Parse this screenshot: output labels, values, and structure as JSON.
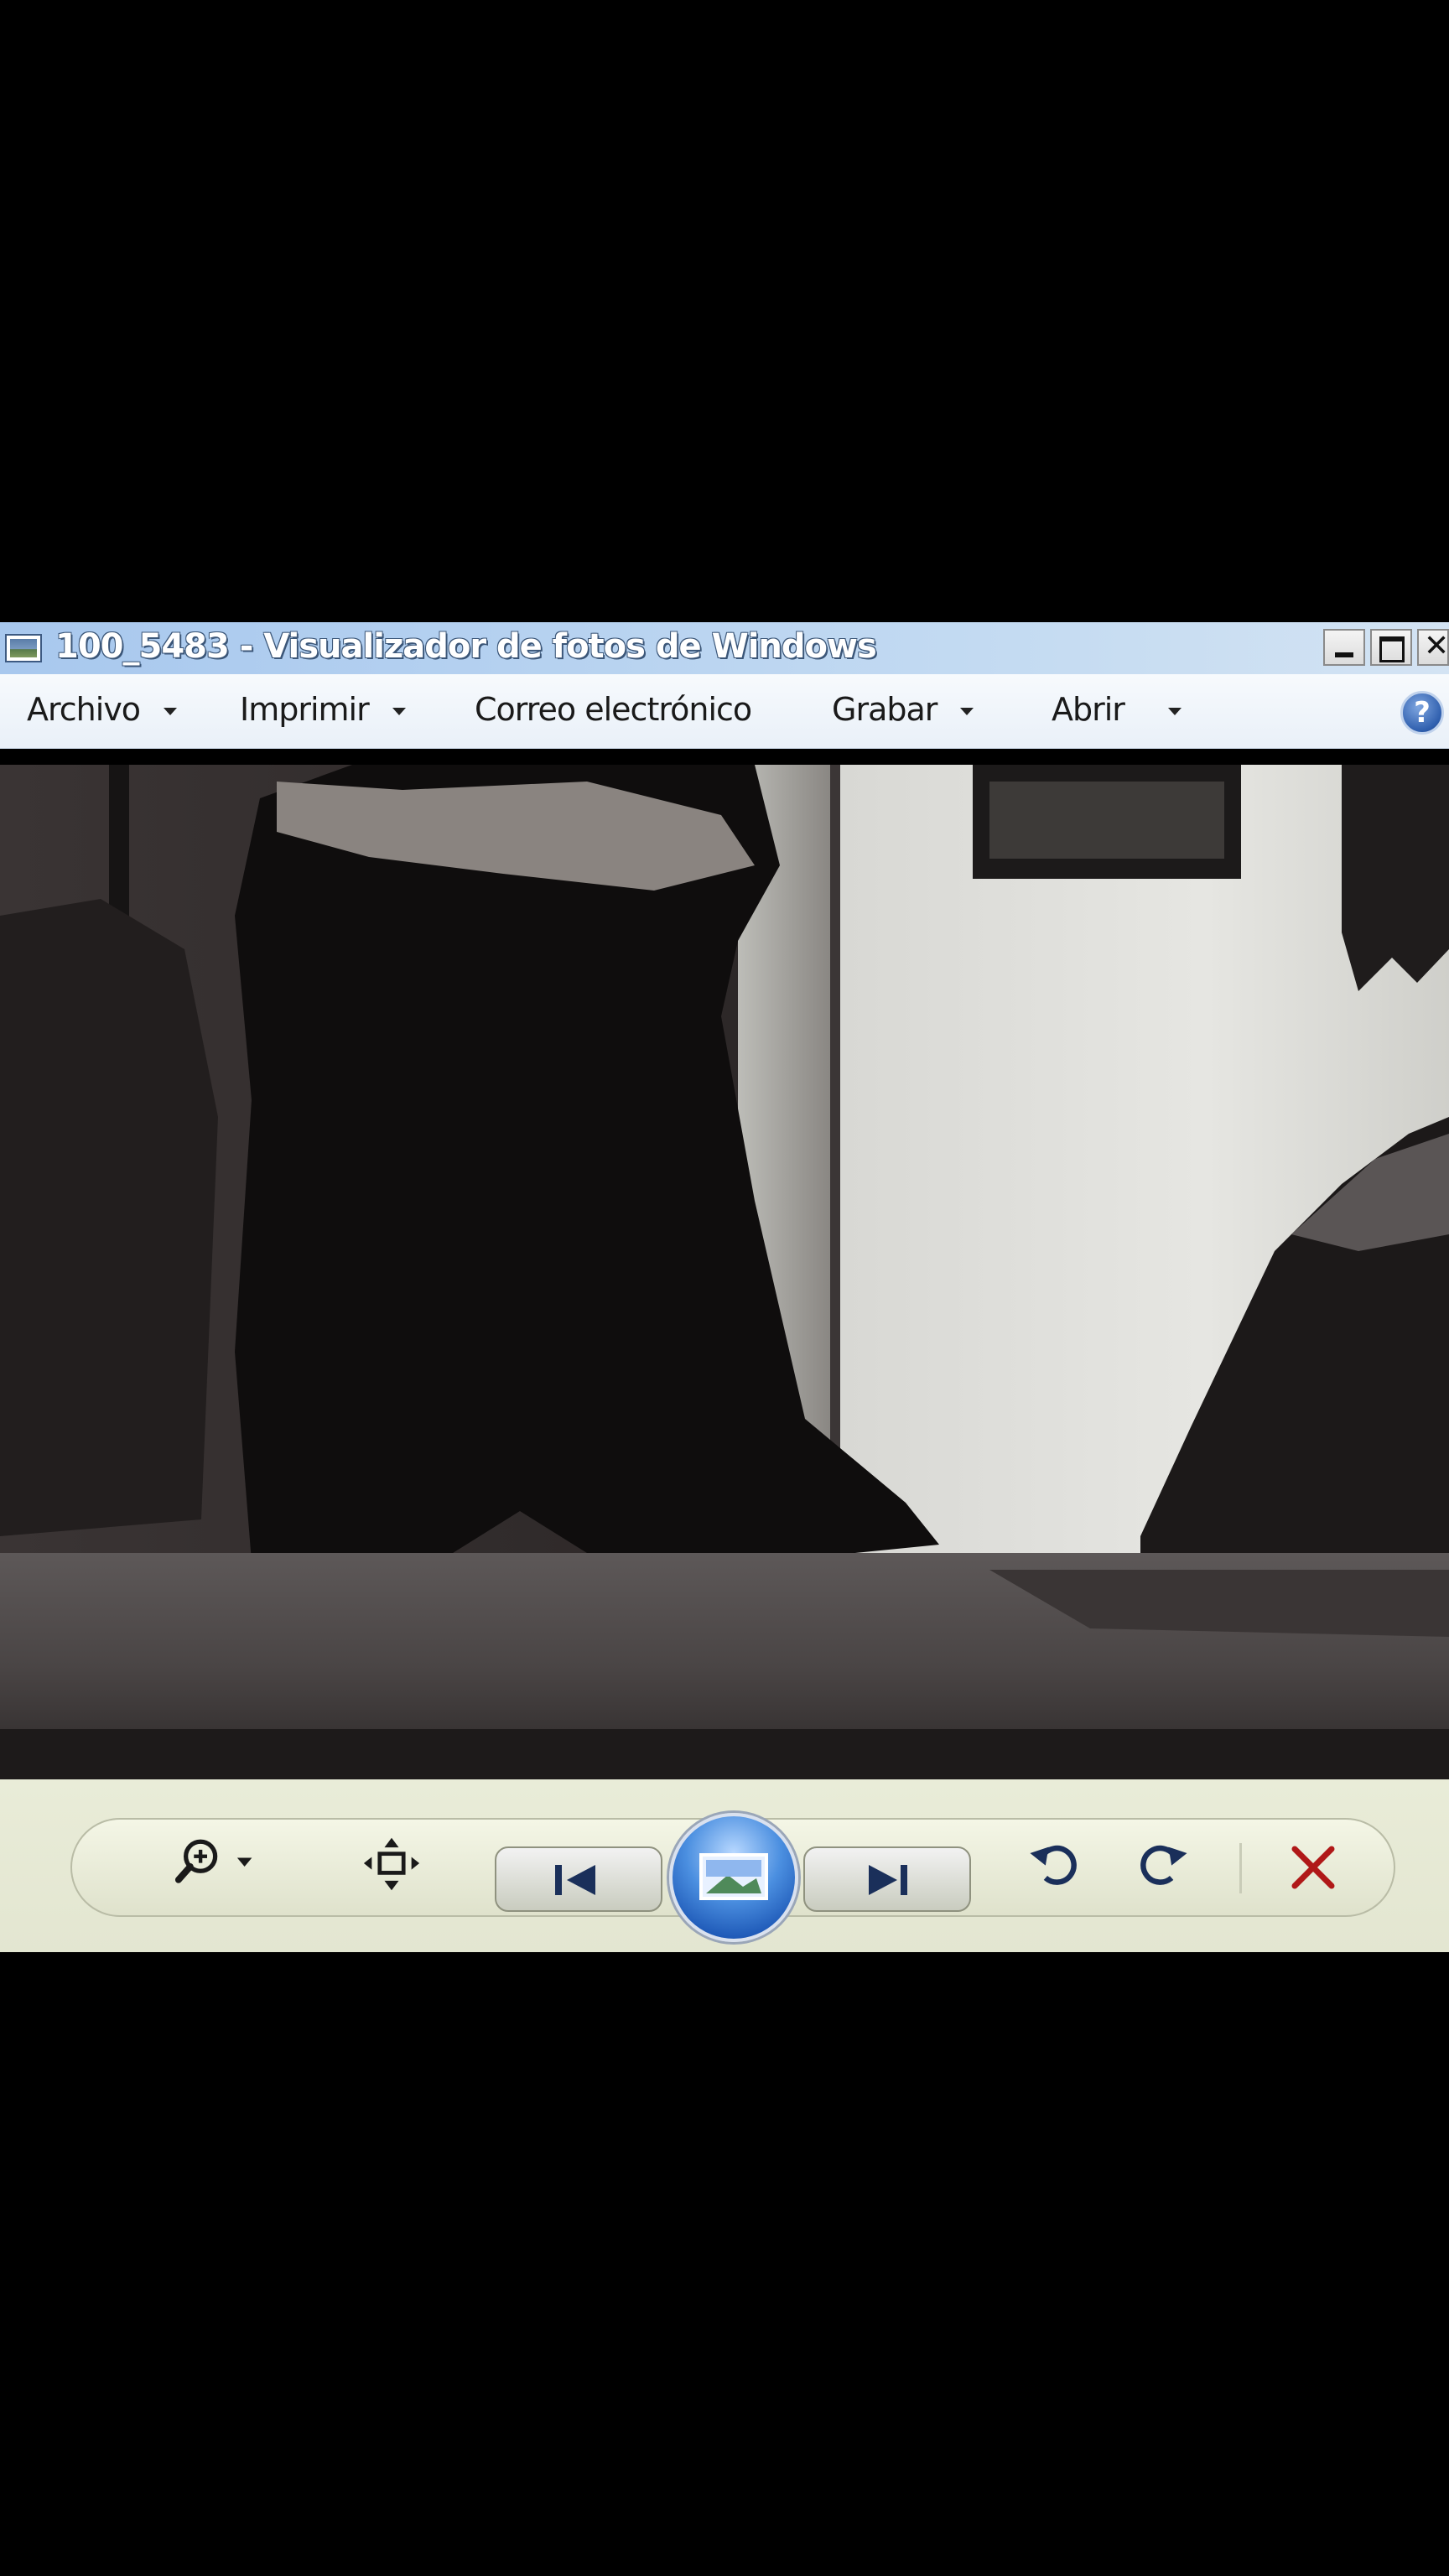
{
  "window": {
    "title": "100_5483 - Visualizador de fotos de Windows"
  },
  "menu": {
    "items": [
      {
        "label": "Archivo",
        "dropdown": true
      },
      {
        "label": "Imprimir",
        "dropdown": true
      },
      {
        "label": "Correo electrónico",
        "dropdown": false
      },
      {
        "label": "Grabar",
        "dropdown": true
      },
      {
        "label": "Abrir",
        "dropdown": true
      }
    ],
    "help_symbol": "?"
  },
  "controls": {
    "zoom": "zoom-icon",
    "actual_size": "fit-window-icon",
    "previous": "previous-icon",
    "slideshow": "slideshow-icon",
    "next": "next-icon",
    "rotate_left": "rotate-counterclockwise-icon",
    "rotate_right": "rotate-clockwise-icon",
    "delete": "delete-icon"
  },
  "colors": {
    "title_bar": "#b5d1f0",
    "control_bar": "#e6e9d4",
    "slideshow_accent": "#3f7fd4",
    "delete_red": "#b01818"
  }
}
